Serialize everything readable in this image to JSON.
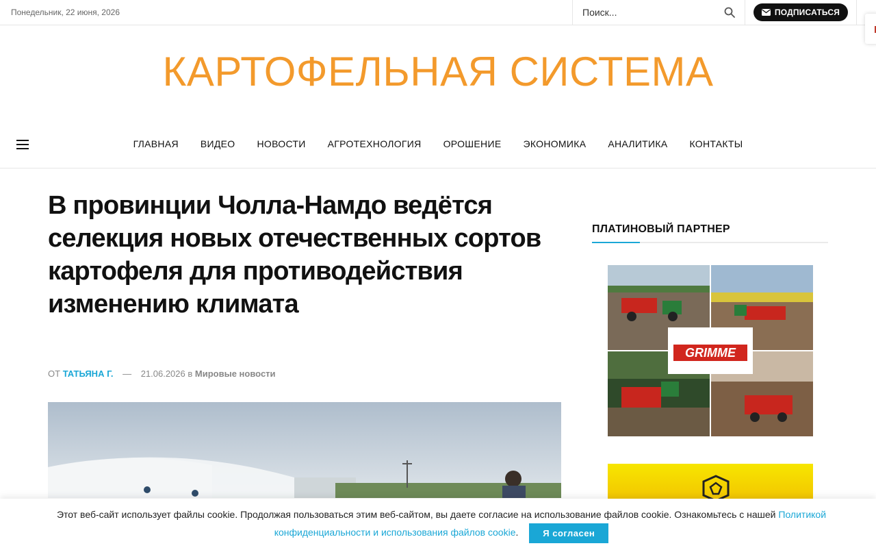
{
  "topbar": {
    "date": "Понедельник, 22 июня, 2026",
    "search_placeholder": "Поиск...",
    "subscribe_label": "ПОДПИСАТЬСЯ"
  },
  "site": {
    "logo_text": "КАРТОФЕЛЬНАЯ СИСТЕМА",
    "accent_color": "#f39a2c",
    "link_color": "#1aa7d6"
  },
  "nav": {
    "items": [
      "ГЛАВНАЯ",
      "ВИДЕО",
      "НОВОСТИ",
      "АГРОТЕХНОЛОГИЯ",
      "ОРОШЕНИЕ",
      "ЭКОНОМИКА",
      "АНАЛИТИКА",
      "КОНТАКТЫ"
    ]
  },
  "article": {
    "title": "В провинции Чолла-Намдо ведётся селекция новых отечественных сортов картофеля для противодействия изменению климата",
    "by_label": "ОТ",
    "author": "Татьяна Г.",
    "dash": "—",
    "date": "21.06.2026",
    "in_label": "в",
    "category": "Мировые новости"
  },
  "sidebar": {
    "title": "ПЛАТИНОВЫЙ ПАРТНЕР",
    "partner_brand": "GRIMME"
  },
  "cookie": {
    "text": "Этот веб-сайт использует файлы cookie. Продолжая пользоваться этим веб-сайтом, вы даете согласие на использование файлов cookie. Ознакомьтесь с нашей",
    "link_text": "Политикой конфиденциальности и использования файлов cookie",
    "after_link": ".",
    "accept_label": "Я согласен"
  },
  "icons": {
    "search": "search-icon",
    "mail": "mail-icon",
    "menu": "hamburger-menu-icon"
  }
}
